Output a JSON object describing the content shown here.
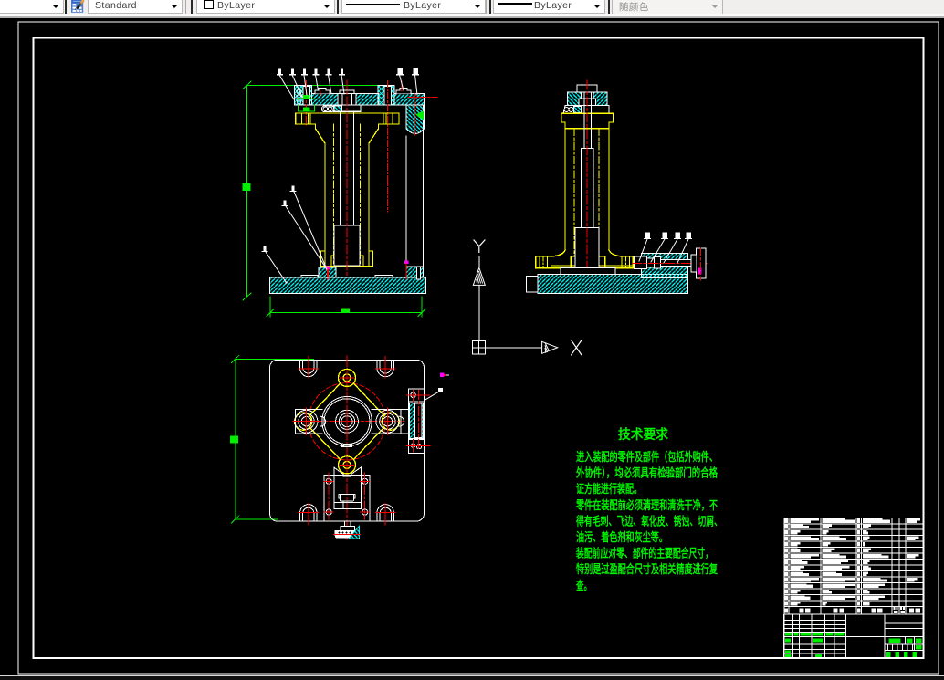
{
  "toolbar": {
    "leading_combo": {
      "value": ""
    },
    "table_style_combo": {
      "value": "Standard"
    },
    "color_combo": {
      "value": "ByLayer",
      "swatch": "white-square"
    },
    "linetype_combo": {
      "value": "ByLayer",
      "symbol": "thin-line"
    },
    "lineweight_combo": {
      "value": "ByLayer",
      "symbol": "thick-line"
    },
    "plotstyle_combo": {
      "value": "随颜色",
      "disabled": true
    },
    "icons": {
      "table_style_icon": "table-with-pen"
    }
  },
  "ucs": {
    "x_label": "X",
    "y_label": "Y"
  },
  "tech": {
    "title": "技术要求",
    "lines": [
      "进入装配的零件及部件（包括外购件、",
      "外协件），均必须具有检验部门的合格",
      "证方能进行装配。",
      "零件在装配前必须清理和清洗干净，不",
      "得有毛刺、飞边、氧化皮、锈蚀、切屑、",
      "油污、着色剂和灰尘等。",
      "装配前应对零、部件的主要配合尺寸，",
      "特别是过盈配合尺寸及相关精度进行复",
      "查。"
    ]
  },
  "colors": {
    "hatch": "#00e8e8",
    "outline": "#ffffff",
    "hidden": "#f0f000",
    "center": "#ff0000",
    "dimension": "#00e400",
    "detail": "#ff00ff",
    "text_green": "#00e400"
  },
  "parts_list": {
    "geom": {
      "x": [
        858.8,
        863.8,
        899.0,
        938.0,
        943.5,
        977.2,
        984.8,
        992.0,
        1011.5
      ],
      "y_top": 567.3,
      "row_h": 6.47,
      "n_rows": 15,
      "header_h": 8.7
    },
    "header_labels": [
      "序号",
      "代号",
      "名称",
      "数量",
      "材料",
      "单件",
      "总计",
      "备注"
    ],
    "rows": [
      {
        "c2": 1.0,
        "c3": 1.0,
        "c5": 1.0,
        "c8": 0.9
      },
      {
        "c2": 0.65,
        "c3": 0.3,
        "c5": 0.3,
        "c8": 0
      },
      {
        "c2": 0.35,
        "c3": 0.2,
        "c5": 0.2,
        "c8": 0
      },
      {
        "c2": 1.0,
        "c3": 0.75,
        "c5": 0.25,
        "c8": 0.8
      },
      {
        "c2": 0.35,
        "c3": 0.25,
        "c5": 0.1,
        "c8": 0
      },
      {
        "c2": 0.35,
        "c3": 0.4,
        "c5": 0.3,
        "c8": 0
      },
      {
        "c2": 1.0,
        "c3": 0.75,
        "c5": 0.95,
        "c8": 0.8
      },
      {
        "c2": 0.6,
        "c3": 0.8,
        "c5": 0.25,
        "c8": 0
      },
      {
        "c2": 0.5,
        "c3": 0.85,
        "c5": 0.3,
        "c8": 0
      },
      {
        "c2": 0.65,
        "c3": 0.6,
        "c5": 0.2,
        "c8": 0
      },
      {
        "c2": 1.0,
        "c3": 1.0,
        "c5": 0.9,
        "c8": 0.7
      },
      {
        "c2": 0.8,
        "c3": 1.0,
        "c5": 0.8,
        "c8": 0
      },
      {
        "c2": 0.35,
        "c3": 0.3,
        "c5": 0.25,
        "c8": 0
      },
      {
        "c2": 0.7,
        "c3": 1.0,
        "c5": 0.8,
        "c8": 0
      },
      {
        "c2": 0.35,
        "c3": 0.15,
        "c5": 0.25,
        "c8": 0
      }
    ]
  },
  "title_block": {
    "x_left": [
      858.8,
      868.3,
      875.5,
      889.0,
      903.4,
      913.8,
      926.6
    ],
    "x_mid_right": 968.8,
    "x_right": 1011.5,
    "y": [
      673.0,
      679.6,
      684.4,
      688.3,
      692.3,
      697.5,
      705.9,
      711.5,
      716.2,
      721.3
    ]
  }
}
